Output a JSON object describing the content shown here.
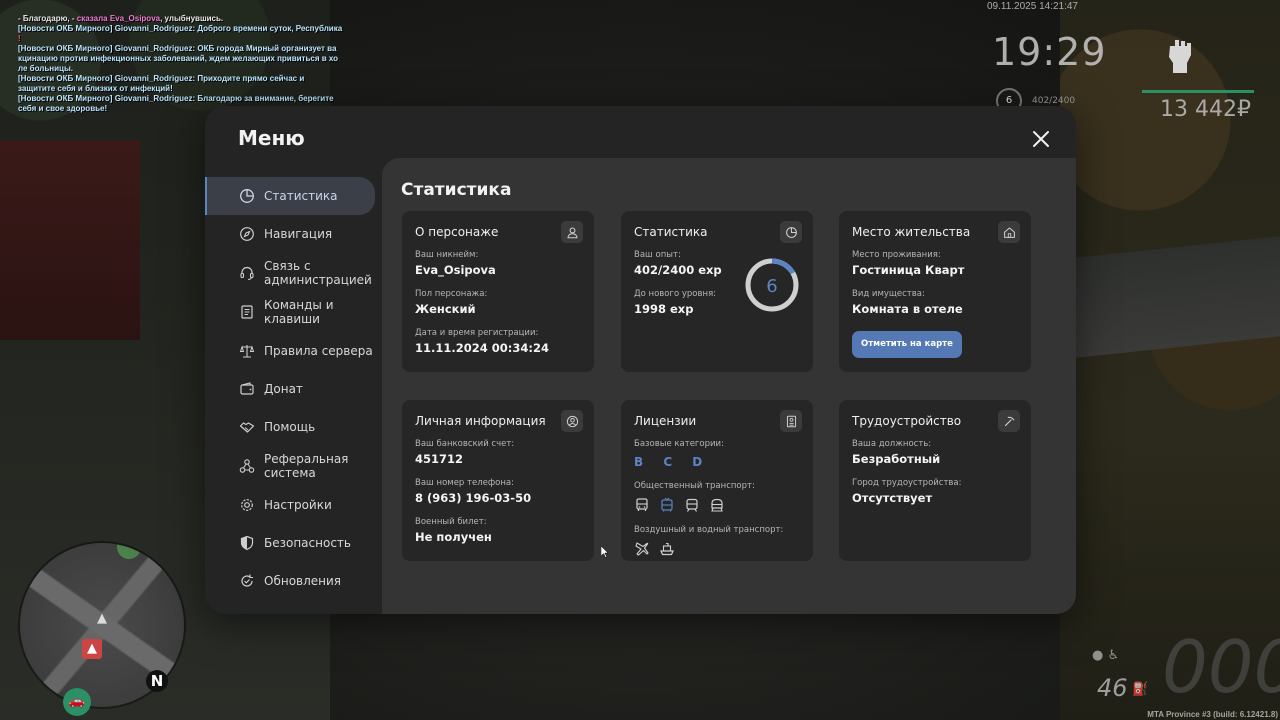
{
  "chat": {
    "lines": [
      {
        "prefix": "- Благодарю, - ",
        "pink": "сказала Eva_Osipova",
        "rest": ", улыбнувшись."
      },
      {
        "text": "[Новости ОКБ Мирного] Giovanni_Rodriguez: Доброго времени суток, Республика",
        "tail": "!"
      },
      {
        "text": "[Новости ОКБ Мирного] Giovanni_Rodriguez: ОКБ города Мирный организует ва"
      },
      {
        "text": "кцинацию против инфекционных заболеваний, ждем желающих привиться в хо"
      },
      {
        "text": "ле больницы."
      },
      {
        "text": "[Новости ОКБ Мирного] Giovanni_Rodriguez: Приходите прямо сейчас и"
      },
      {
        "text": " защитите себя и близких от инфекций!"
      },
      {
        "text": "[Новости ОКБ Мирного] Giovanni_Rodriguez: Благодарю за внимание, берегите"
      },
      {
        "text": " себя и свое здоровье!"
      }
    ]
  },
  "hud": {
    "date": "09.11.2025 14:21:47",
    "clock": "19:29",
    "money": "13 442₽",
    "level": "6",
    "exp": "402/2400",
    "fuel": "46",
    "speed": "000",
    "build": "MTA Province #3 (build: 6.12421.8)",
    "compass": "N"
  },
  "menu": {
    "title": "Меню",
    "close_icon": "close-icon",
    "sidebar": [
      {
        "label": "Статистика",
        "icon": "pie-chart-icon",
        "active": true
      },
      {
        "label": "Навигация",
        "icon": "compass-icon"
      },
      {
        "label": "Связь с администрацией",
        "icon": "headset-icon"
      },
      {
        "label": "Команды и клавиши",
        "icon": "document-icon"
      },
      {
        "label": "Правила сервера",
        "icon": "scales-icon"
      },
      {
        "label": "Донат",
        "icon": "wallet-icon"
      },
      {
        "label": "Помощь",
        "icon": "handshake-icon"
      },
      {
        "label": "Реферальная система",
        "icon": "network-icon"
      },
      {
        "label": "Настройки",
        "icon": "gear-icon"
      },
      {
        "label": "Безопасность",
        "icon": "shield-icon"
      },
      {
        "label": "Обновления",
        "icon": "refresh-icon"
      }
    ],
    "content_title": "Статистика",
    "cards": {
      "character": {
        "title": "О персонаже",
        "nickname_label": "Ваш никнейм:",
        "nickname": "Eva_Osipova",
        "gender_label": "Пол персонажа:",
        "gender": "Женский",
        "reg_label": "Дата и время регистрации:",
        "reg": "11.11.2024 00:34:24"
      },
      "stats": {
        "title": "Статистика",
        "exp_label": "Ваш опыт:",
        "exp": "402/2400 exp",
        "next_label": "До нового уровня:",
        "next": "1998 exp",
        "level": "6",
        "progress": 0.1675
      },
      "residence": {
        "title": "Место жительства",
        "place_label": "Место проживания:",
        "place": "Гостиница Кварт",
        "type_label": "Вид имущества:",
        "type": "Комната в отеле",
        "button": "Отметить на карте"
      },
      "personal": {
        "title": "Личная информация",
        "bank_label": "Ваш банковский счет:",
        "bank": "451712",
        "phone_label": "Ваш номер телефона:",
        "phone": "8 (963) 196-03-50",
        "military_label": "Военный билет:",
        "military": "Не получен"
      },
      "licenses": {
        "title": "Лицензии",
        "base_label": "Базовые категории:",
        "base": "B C D",
        "public_label": "Общественный транспорт:",
        "air_label": "Воздушный и водный транспорт:"
      },
      "job": {
        "title": "Трудоустройство",
        "position_label": "Ваша должность:",
        "position": "Безработный",
        "city_label": "Город трудоустройства:",
        "city": "Отсутствует"
      }
    }
  }
}
